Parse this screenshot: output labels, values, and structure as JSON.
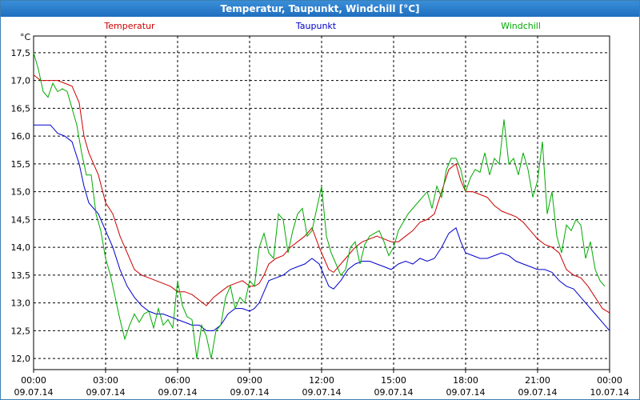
{
  "window": {
    "title": "Temperatur, Taupunkt, Windchill [°C]"
  },
  "chart_data": {
    "type": "line",
    "title": "Temperatur, Taupunkt, Windchill [°C]",
    "ylabel": "°C",
    "xlabel": "",
    "ylim": [
      11.8,
      17.8
    ],
    "xlim": [
      0,
      24
    ],
    "grid": true,
    "legend_position": "top",
    "y_ticks": [
      "12,0",
      "12,5",
      "13,0",
      "13,5",
      "14,0",
      "14,5",
      "15,0",
      "15,5",
      "16,0",
      "16,5",
      "17,0",
      "17,5"
    ],
    "x_ticks": [
      {
        "time": "00:00",
        "date": "09.07.14"
      },
      {
        "time": "03:00",
        "date": "09.07.14"
      },
      {
        "time": "06:00",
        "date": "09.07.14"
      },
      {
        "time": "09:00",
        "date": "09.07.14"
      },
      {
        "time": "12:00",
        "date": "09.07.14"
      },
      {
        "time": "15:00",
        "date": "09.07.14"
      },
      {
        "time": "18:00",
        "date": "09.07.14"
      },
      {
        "time": "21:00",
        "date": "09.07.14"
      },
      {
        "time": "00:00",
        "date": "10.07.14"
      }
    ],
    "series": [
      {
        "name": "Temperatur",
        "color": "#cc0000",
        "x": [
          0,
          0.3,
          0.7,
          1.0,
          1.3,
          1.6,
          1.9,
          2.1,
          2.3,
          2.5,
          2.7,
          3.0,
          3.3,
          3.6,
          3.9,
          4.2,
          4.5,
          4.8,
          5.1,
          5.4,
          5.7,
          6.0,
          6.3,
          6.6,
          6.9,
          7.2,
          7.5,
          7.8,
          8.1,
          8.4,
          8.7,
          9.0,
          9.2,
          9.4,
          9.6,
          9.8,
          10.1,
          10.4,
          10.7,
          11.0,
          11.3,
          11.6,
          11.9,
          12.1,
          12.3,
          12.5,
          12.8,
          13.1,
          13.4,
          13.7,
          14.0,
          14.3,
          14.6,
          14.9,
          15.2,
          15.5,
          15.8,
          16.1,
          16.4,
          16.7,
          17.0,
          17.3,
          17.6,
          17.8,
          18.0,
          18.3,
          18.6,
          18.9,
          19.2,
          19.5,
          19.8,
          20.1,
          20.4,
          20.7,
          21.0,
          21.3,
          21.6,
          21.9,
          22.2,
          22.5,
          22.8,
          23.1,
          23.4,
          23.7,
          24.0
        ],
        "values": [
          17.1,
          17.0,
          17.0,
          17.0,
          16.95,
          16.9,
          16.6,
          16.0,
          15.7,
          15.5,
          15.3,
          14.8,
          14.6,
          14.2,
          13.9,
          13.6,
          13.5,
          13.45,
          13.4,
          13.35,
          13.3,
          13.2,
          13.2,
          13.15,
          13.05,
          12.95,
          13.1,
          13.2,
          13.3,
          13.35,
          13.4,
          13.3,
          13.3,
          13.35,
          13.5,
          13.7,
          13.8,
          13.85,
          14.0,
          14.1,
          14.2,
          14.35,
          14.0,
          13.8,
          13.6,
          13.55,
          13.7,
          13.85,
          14.0,
          14.1,
          14.15,
          14.2,
          14.15,
          14.1,
          14.1,
          14.2,
          14.3,
          14.45,
          14.5,
          14.6,
          15.0,
          15.4,
          15.5,
          15.2,
          15.0,
          15.0,
          14.95,
          14.9,
          14.75,
          14.65,
          14.6,
          14.55,
          14.45,
          14.3,
          14.15,
          14.05,
          14.0,
          13.9,
          13.6,
          13.5,
          13.45,
          13.3,
          13.1,
          12.9,
          12.82
        ]
      },
      {
        "name": "Taupunkt",
        "color": "#0000cc",
        "x": [
          0,
          0.3,
          0.7,
          1.0,
          1.3,
          1.6,
          1.9,
          2.1,
          2.3,
          2.5,
          2.7,
          3.0,
          3.3,
          3.6,
          3.9,
          4.2,
          4.5,
          4.8,
          5.1,
          5.4,
          5.7,
          6.0,
          6.3,
          6.6,
          6.9,
          7.2,
          7.5,
          7.8,
          8.1,
          8.4,
          8.7,
          9.0,
          9.2,
          9.4,
          9.6,
          9.8,
          10.1,
          10.4,
          10.7,
          11.0,
          11.3,
          11.6,
          11.9,
          12.1,
          12.3,
          12.5,
          12.8,
          13.1,
          13.4,
          13.7,
          14.0,
          14.3,
          14.6,
          14.9,
          15.2,
          15.5,
          15.8,
          16.1,
          16.4,
          16.7,
          17.0,
          17.3,
          17.6,
          17.8,
          18.0,
          18.3,
          18.6,
          18.9,
          19.2,
          19.5,
          19.8,
          20.1,
          20.4,
          20.7,
          21.0,
          21.3,
          21.6,
          21.9,
          22.2,
          22.5,
          22.8,
          23.1,
          23.4,
          23.7,
          24.0
        ],
        "values": [
          16.2,
          16.2,
          16.2,
          16.05,
          16.0,
          15.9,
          15.5,
          15.1,
          14.8,
          14.7,
          14.6,
          14.3,
          14.0,
          13.6,
          13.3,
          13.1,
          12.95,
          12.85,
          12.8,
          12.8,
          12.75,
          12.7,
          12.65,
          12.6,
          12.6,
          12.5,
          12.5,
          12.6,
          12.8,
          12.9,
          12.9,
          12.85,
          12.9,
          13.0,
          13.2,
          13.4,
          13.45,
          13.5,
          13.6,
          13.65,
          13.7,
          13.8,
          13.7,
          13.5,
          13.3,
          13.25,
          13.4,
          13.6,
          13.7,
          13.75,
          13.75,
          13.7,
          13.65,
          13.6,
          13.7,
          13.75,
          13.7,
          13.8,
          13.75,
          13.8,
          14.0,
          14.25,
          14.35,
          14.1,
          13.9,
          13.85,
          13.8,
          13.8,
          13.85,
          13.9,
          13.85,
          13.75,
          13.7,
          13.65,
          13.6,
          13.6,
          13.55,
          13.4,
          13.3,
          13.25,
          13.1,
          12.95,
          12.8,
          12.65,
          12.5
        ]
      },
      {
        "name": "Windchill",
        "color": "#00aa00",
        "x": [
          0,
          0.2,
          0.4,
          0.6,
          0.8,
          1.0,
          1.2,
          1.4,
          1.6,
          1.8,
          2.0,
          2.2,
          2.4,
          2.6,
          2.8,
          3.0,
          3.2,
          3.4,
          3.6,
          3.8,
          4.0,
          4.2,
          4.4,
          4.6,
          4.8,
          5.0,
          5.2,
          5.4,
          5.6,
          5.8,
          6.0,
          6.2,
          6.4,
          6.6,
          6.8,
          7.0,
          7.2,
          7.4,
          7.6,
          7.8,
          8.0,
          8.2,
          8.4,
          8.6,
          8.8,
          9.0,
          9.2,
          9.4,
          9.6,
          9.8,
          10.0,
          10.2,
          10.4,
          10.6,
          10.8,
          11.0,
          11.2,
          11.4,
          11.6,
          11.8,
          12.0,
          12.2,
          12.4,
          12.6,
          12.8,
          13.0,
          13.2,
          13.4,
          13.6,
          13.8,
          14.0,
          14.2,
          14.4,
          14.6,
          14.8,
          15.0,
          15.2,
          15.4,
          15.6,
          15.8,
          16.0,
          16.2,
          16.4,
          16.6,
          16.8,
          17.0,
          17.2,
          17.4,
          17.6,
          17.8,
          18.0,
          18.2,
          18.4,
          18.6,
          18.8,
          19.0,
          19.2,
          19.4,
          19.6,
          19.8,
          20.0,
          20.2,
          20.4,
          20.6,
          20.8,
          21.0,
          21.2,
          21.4,
          21.6,
          21.8,
          22.0,
          22.2,
          22.4,
          22.6,
          22.8,
          23.0,
          23.2,
          23.4,
          23.6,
          23.8
        ],
        "values": [
          17.5,
          17.2,
          16.8,
          16.7,
          16.95,
          16.8,
          16.85,
          16.8,
          16.5,
          16.2,
          15.7,
          15.3,
          15.3,
          14.6,
          14.3,
          13.8,
          13.5,
          13.1,
          12.7,
          12.35,
          12.6,
          12.8,
          12.65,
          12.8,
          12.85,
          12.55,
          12.9,
          12.6,
          12.7,
          12.55,
          13.4,
          12.95,
          12.75,
          12.7,
          12.0,
          12.6,
          12.4,
          12.0,
          12.5,
          12.6,
          13.1,
          13.3,
          12.9,
          13.1,
          13.0,
          13.4,
          13.3,
          14.0,
          14.25,
          13.9,
          13.8,
          14.6,
          14.5,
          13.9,
          14.3,
          14.6,
          14.7,
          14.2,
          14.3,
          14.7,
          15.1,
          14.2,
          13.9,
          13.7,
          13.5,
          13.6,
          14.0,
          14.1,
          13.7,
          14.05,
          14.2,
          14.25,
          14.3,
          14.1,
          13.85,
          14.0,
          14.3,
          14.45,
          14.6,
          14.7,
          14.8,
          14.9,
          15.0,
          14.7,
          15.1,
          14.9,
          15.4,
          15.6,
          15.6,
          15.4,
          15.0,
          15.25,
          15.4,
          15.35,
          15.7,
          15.3,
          15.6,
          15.5,
          16.3,
          15.5,
          15.6,
          15.3,
          15.7,
          15.4,
          14.9,
          15.2,
          15.9,
          14.6,
          15.0,
          14.2,
          13.9,
          14.4,
          14.3,
          14.5,
          14.4,
          13.8,
          14.1,
          13.6,
          13.4,
          13.3
        ]
      }
    ]
  }
}
